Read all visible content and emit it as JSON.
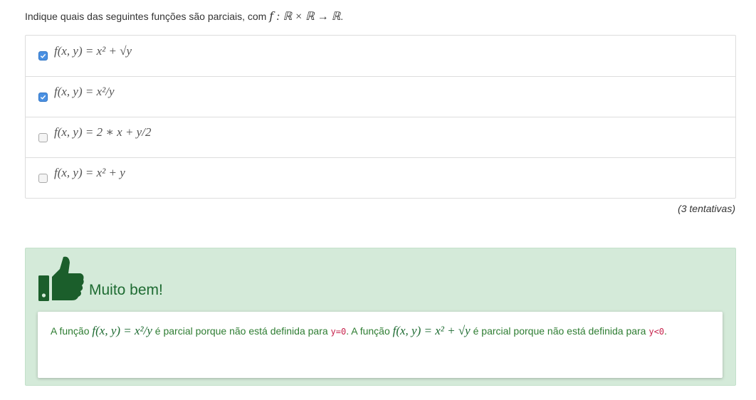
{
  "question": {
    "prefix": "Indique quais das seguintes funções são parciais, com ",
    "formula": "𝑓 : ℝ × ℝ → ℝ",
    "suffix": "."
  },
  "options": [
    {
      "checked": true,
      "label": "f(x, y) = x² + √y"
    },
    {
      "checked": true,
      "label": "f(x, y) = x²/y"
    },
    {
      "checked": false,
      "label": "f(x, y) = 2 ∗ x + y/2"
    },
    {
      "checked": false,
      "label": "f(x, y) = x² + y"
    }
  ],
  "attempts": "(3 tentativas)",
  "feedback": {
    "title": "Muito bem!",
    "icon": "thumbs-up-icon",
    "part1": "A função ",
    "formula1": "f(x, y) = x²/y",
    "part2": " é parcial porque não está definida para ",
    "code1": "y=0",
    "part3": ". A função ",
    "formula2": "f(x, y) = x² + √y",
    "part4": " é parcial porque não está definida para ",
    "code2": "y<0",
    "part5": "."
  },
  "colors": {
    "checkbox_checked": "#4a90e2",
    "feedback_bg": "#d4ead9",
    "feedback_text": "#2e7d32",
    "code_text": "#c7254e"
  }
}
